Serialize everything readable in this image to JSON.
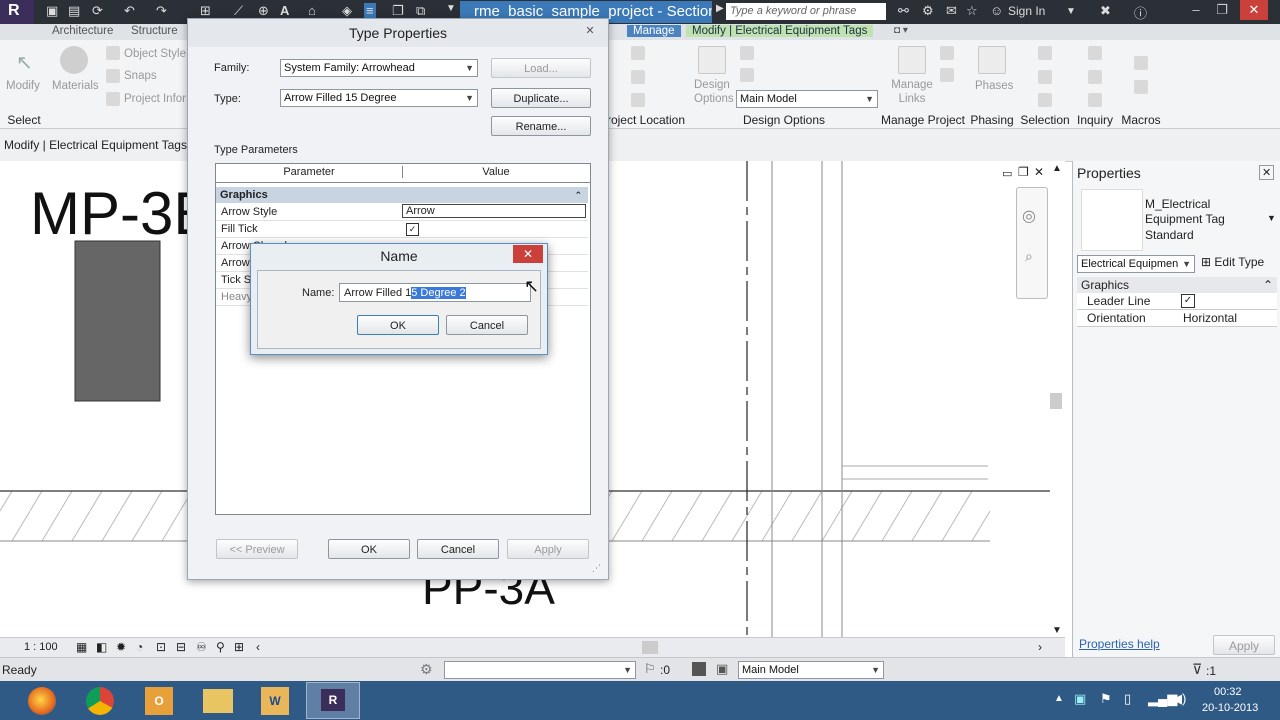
{
  "app": {
    "document_title": "rme_basic_sample_project - Section: ...",
    "search_placeholder": "Type a keyword or phrase",
    "sign_in": "Sign In"
  },
  "ribbon": {
    "tabs": [
      "Architecture",
      "Structure"
    ],
    "manage_tab": "Manage",
    "context_tab": "Modify | Electrical Equipment Tags",
    "buttons": {
      "modify": "Modify",
      "materials": "Materials",
      "object_styles": "Object Style",
      "snaps": "Snaps",
      "project_info": "Project Infor",
      "design_options": "Design Options",
      "main_model": "Main Model",
      "manage_links": "Manage Links",
      "phases": "Phases"
    },
    "panels": {
      "select": "Select",
      "project_location": "roject Location",
      "design_options": "Design Options",
      "manage_project": "Manage Project",
      "phasing": "Phasing",
      "selection": "Selection",
      "inquiry": "Inquiry",
      "macros": "Macros"
    }
  },
  "options_bar": {
    "label": "Modify | Electrical Equipment Tags"
  },
  "canvas": {
    "tag1": "MP-3E",
    "tag2": "PP-3A",
    "scale": "1 : 100"
  },
  "properties": {
    "title": "Properties",
    "type_name": "M_Electrical Equipment Tag",
    "type_sub": "Standard",
    "selector": "Electrical Equipmen",
    "edit_type": "Edit Type",
    "group": "Graphics",
    "rows": [
      {
        "label": "Leader Line",
        "value": "✓"
      },
      {
        "label": "Orientation",
        "value": "Horizontal"
      }
    ],
    "help": "Properties help",
    "apply": "Apply"
  },
  "status": {
    "ready": "Ready",
    "zero": ":0",
    "main_model": "Main Model",
    "filter": ":1"
  },
  "taskbar": {
    "time": "00:32",
    "date": "20-10-2013"
  },
  "type_properties": {
    "title": "Type Properties",
    "family_label": "Family:",
    "family_value": "System Family: Arrowhead",
    "type_label": "Type:",
    "type_value": "Arrow Filled 15 Degree",
    "load_btn": "Load...",
    "duplicate_btn": "Duplicate...",
    "rename_btn": "Rename...",
    "section_label": "Type Parameters",
    "col_param": "Parameter",
    "col_value": "Value",
    "group": "Graphics",
    "rows": [
      {
        "param": "Arrow Style",
        "value": "Arrow"
      },
      {
        "param": "Fill Tick",
        "value": "✓"
      },
      {
        "param": "Arrow Closed",
        "value": ""
      },
      {
        "param": "Arrow Width Angle",
        "value": ""
      },
      {
        "param": "Tick Size",
        "value": ""
      },
      {
        "param": "Heavy End Pen Weight",
        "value": ""
      }
    ],
    "preview_btn": "<< Preview",
    "ok_btn": "OK",
    "cancel_btn": "Cancel",
    "apply_btn": "Apply"
  },
  "name_dialog": {
    "title": "Name",
    "name_label": "Name:",
    "name_prefix": "Arrow Filled 1",
    "name_selected": "5 Degree 2",
    "ok_btn": "OK",
    "cancel_btn": "Cancel"
  },
  "colors": {
    "accent": "#3b79b8",
    "context_tab": "#bfe3b0",
    "taskbar": "#2f5a86",
    "close_red": "#c9413a"
  }
}
